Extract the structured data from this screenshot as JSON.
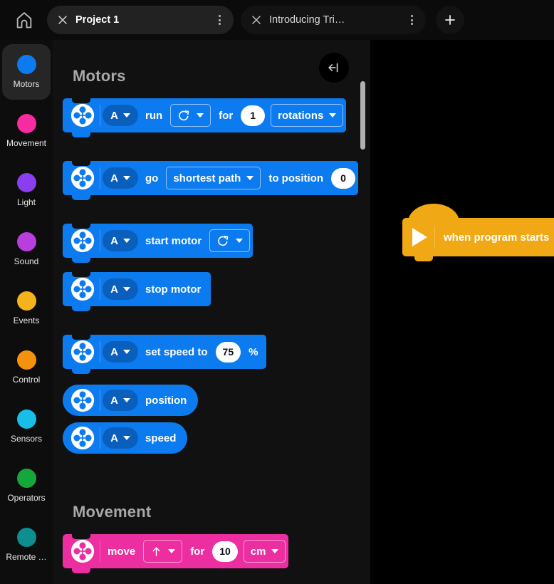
{
  "topbar": {
    "home_icon": "home-icon",
    "new_tab_icon": "plus-icon",
    "tabs": [
      {
        "label": "Project 1",
        "close_icon": "close-icon",
        "menu_icon": "kebab-menu-icon",
        "active": true
      },
      {
        "label": "Introducing Tri…",
        "close_icon": "close-icon",
        "menu_icon": "kebab-menu-icon",
        "active": false
      }
    ]
  },
  "sidebar": {
    "items": [
      {
        "label": "Motors",
        "color": "#0d7bf0",
        "selected": true
      },
      {
        "label": "Movement",
        "color": "#f82ba0",
        "selected": false
      },
      {
        "label": "Light",
        "color": "#8a3ef0",
        "selected": false
      },
      {
        "label": "Sound",
        "color": "#b93ede",
        "selected": false
      },
      {
        "label": "Events",
        "color": "#f5b21b",
        "selected": false
      },
      {
        "label": "Control",
        "color": "#f5920d",
        "selected": false
      },
      {
        "label": "Sensors",
        "color": "#18bde8",
        "selected": false
      },
      {
        "label": "Operators",
        "color": "#14a83c",
        "selected": false
      },
      {
        "label": "Remote …",
        "color": "#0d8f8f",
        "selected": false
      }
    ]
  },
  "palette": {
    "collapse_icon": "collapse-panel-icon",
    "sections": [
      {
        "title": "Motors"
      },
      {
        "title": "Movement"
      }
    ],
    "blocks": {
      "motor_run": {
        "port": "A",
        "verb": "run",
        "direction_icon": "clockwise-arrow-icon",
        "for_label": "for",
        "amount": "1",
        "unit": "rotations"
      },
      "motor_goto": {
        "port": "A",
        "verb": "go",
        "path": "shortest path",
        "to_label": "to position",
        "position": "0"
      },
      "motor_start": {
        "port": "A",
        "verb": "start motor",
        "direction_icon": "clockwise-arrow-icon"
      },
      "motor_stop": {
        "port": "A",
        "verb": "stop motor"
      },
      "motor_set_speed": {
        "port": "A",
        "verb": "set speed to",
        "speed": "75",
        "percent": "%"
      },
      "motor_position": {
        "port": "A",
        "verb": "position"
      },
      "motor_speed": {
        "port": "A",
        "verb": "speed"
      },
      "move_for": {
        "verb": "move",
        "direction_icon": "up-arrow-icon",
        "for_label": "for",
        "amount": "10",
        "unit": "cm"
      }
    }
  },
  "canvas": {
    "hat_block": {
      "label": "when program starts",
      "icon": "play-triangle-icon"
    }
  },
  "colors": {
    "motors_blue": "#0d7bf0",
    "movement_pink": "#ec2ea0",
    "events_yellow": "#f0a815",
    "panel_bg": "#111111",
    "canvas_bg": "#000000"
  }
}
